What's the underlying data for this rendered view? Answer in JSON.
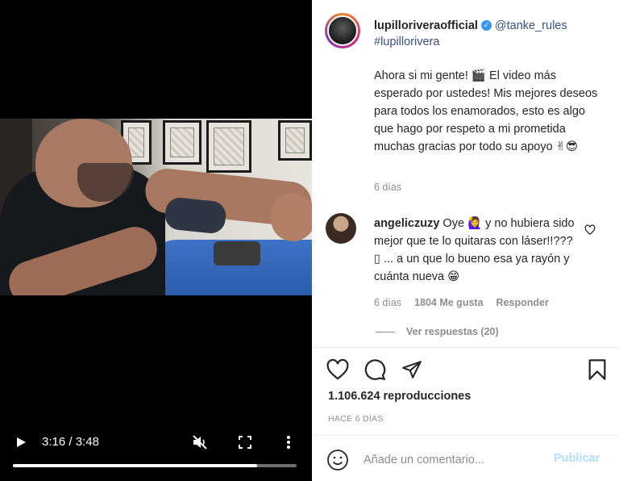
{
  "video": {
    "current_time": "3:16",
    "separator": " / ",
    "duration": "3:48",
    "progress_fraction": 0.86
  },
  "post": {
    "author": "lupilloriveraofficial",
    "mention": "@tanke_rules",
    "hashtag": "#lupillorivera",
    "caption": "Ahora si mi gente! 🎬 El video más esperado por ustedes! Mis mejores deseos para todos los enamorados, esto es algo que hago por respeto a mi prometida muchas gracias por todo su apoyo ✌😎",
    "time": "6 días"
  },
  "comment": {
    "author": "angeliczuzy",
    "text": "Oye 🙋‍♀️ y no hubiera sido mejor que te lo quitaras con láser!!??? ▯ ... a un que lo bueno esa ya rayón y cuánta nueva 😁",
    "time": "6 días",
    "likes": "1804 Me gusta",
    "reply_label": "Responder",
    "view_replies": "Ver respuestas (20)"
  },
  "stats": {
    "views": "1.106.624 reproducciones",
    "ago": "HACE 6 DÍAS"
  },
  "composer": {
    "placeholder": "Añade un comentario...",
    "publish": "Publicar"
  }
}
